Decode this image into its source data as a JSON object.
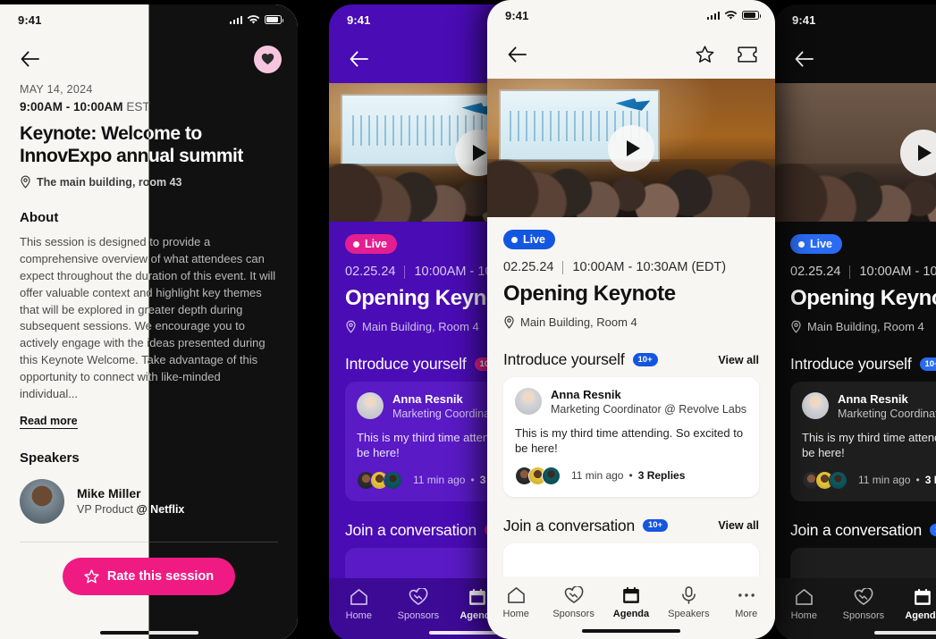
{
  "status_bar": {
    "time": "9:41"
  },
  "session_detail": {
    "date": "MAY 14, 2024",
    "time_main": "9:00AM - 10:00AM",
    "time_zone": "EST",
    "title": "Keynote: Welcome to InnovExpo annual summit",
    "location": "The main building, room 43",
    "about_heading": "About",
    "about_text": "This session is designed to provide a comprehensive overview of what attendees can expect throughout the duration of this event. It will offer valuable context and highlight key themes that will be explored in greater depth during subsequent sessions. We encourage you to actively engage with the ideas presented during this Keynote Welcome. Take advantage of this opportunity to connect with like-minded individual...",
    "read_more": "Read more",
    "speakers_heading": "Speakers",
    "speaker": {
      "name": "Mike Miller",
      "role": "VP Product",
      "company": "@ Netflix"
    },
    "rate_button": "Rate this session",
    "icons": {
      "back": "back-arrow-icon",
      "favorite": "heart-icon",
      "rate": "star-icon",
      "location": "location-pin-icon"
    }
  },
  "keynote": {
    "live_label": "Live",
    "date": "02.25.24",
    "time": "10:00AM - 10:30AM (EDT)",
    "title": "Opening Keynote",
    "location": "Main Building, Room 4",
    "icons": {
      "back": "back-arrow-icon",
      "favorite": "star-icon",
      "ticket": "ticket-icon",
      "play": "play-icon",
      "location": "location-pin-icon"
    },
    "sections": [
      {
        "title": "Introduce yourself",
        "badge": "10+",
        "view_all": "View all",
        "post": {
          "author": "Anna Resnik",
          "role": "Marketing Coordinator @ Revolve Labs",
          "text": "This is my third time attending. So excited to be here!",
          "time_ago": "11 min ago",
          "separator": "•",
          "replies": "3 Replies"
        }
      },
      {
        "title": "Join a conversation",
        "badge": "10+",
        "view_all": "View all"
      }
    ],
    "tabs": [
      {
        "label": "Home",
        "icon": "home-icon",
        "active": false
      },
      {
        "label": "Sponsors",
        "icon": "heart-handshake-icon",
        "active": false
      },
      {
        "label": "Agenda",
        "icon": "calendar-icon",
        "active": true
      },
      {
        "label": "Speakers",
        "icon": "microphone-icon",
        "active": false
      },
      {
        "label": "More",
        "icon": "ellipsis-icon",
        "active": false
      }
    ]
  },
  "themes": {
    "light_bg": "#f7f6f2",
    "dark_bg": "#0c0c0c",
    "purple_bg": "#4a0cb5",
    "accent_blue": "#1356e0",
    "accent_pink": "#e31e90",
    "rate_pink": "#ef1b83",
    "heart_pink": "#f6c6de"
  }
}
